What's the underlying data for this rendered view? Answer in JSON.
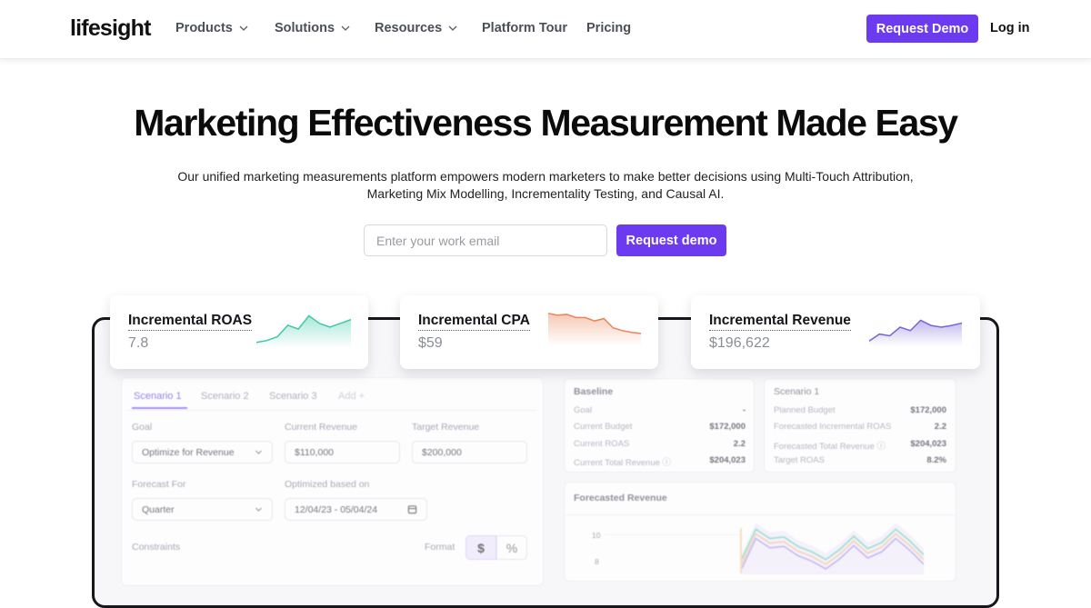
{
  "nav": {
    "logo": "lifesight",
    "items": [
      {
        "label": "Products",
        "has_dropdown": true
      },
      {
        "label": "Solutions",
        "has_dropdown": true
      },
      {
        "label": "Resources",
        "has_dropdown": true
      },
      {
        "label": "Platform Tour",
        "has_dropdown": false
      },
      {
        "label": "Pricing",
        "has_dropdown": false
      }
    ],
    "cta": "Request Demo",
    "login": "Log in"
  },
  "hero": {
    "title": "Marketing Effectiveness Measurement Made Easy",
    "subtitle_line1": "Our unified marketing measurements platform empowers modern marketers to make better decisions using Multi-Touch Attribution,",
    "subtitle_line2": "Marketing Mix Modelling, Incrementality Testing, and Causal AI.",
    "email_placeholder": "Enter your work email",
    "cta": "Request demo"
  },
  "colors": {
    "accent": "#6c3bf0",
    "roas_line": "#3ec9a7",
    "cpa_line": "#e8865a",
    "revenue_line": "#7a63d8"
  },
  "metric_cards": [
    {
      "title": "Incremental ROAS",
      "value": "7.8",
      "trend": "up",
      "sparkline": [
        1,
        1.5,
        2.5,
        5.5,
        4.5,
        8,
        6,
        5,
        6,
        7
      ]
    },
    {
      "title": "Incremental CPA",
      "value": "$59",
      "trend": "down",
      "sparkline": [
        9,
        8.5,
        8.7,
        7.8,
        7.8,
        6.8,
        7.5,
        4.8,
        4,
        3.5,
        3.2
      ]
    },
    {
      "title": "Incremental Revenue",
      "value": "$196,622",
      "trend": "up",
      "sparkline": [
        1,
        3,
        2.5,
        5,
        4,
        7,
        5.5,
        5,
        5.5,
        6.2
      ]
    }
  ],
  "dashboard": {
    "tabs": [
      {
        "label": "Scenario 1",
        "active": true
      },
      {
        "label": "Scenario 2",
        "active": false
      },
      {
        "label": "Scenario 3",
        "active": false
      },
      {
        "label": "Add +",
        "active": false
      }
    ],
    "fields": {
      "goal_label": "Goal",
      "goal_value": "Optimize for Revenue",
      "current_revenue_label": "Current Revenue",
      "current_revenue_value": "$110,000",
      "target_revenue_label": "Target Revenue",
      "target_revenue_value": "$200,000",
      "forecast_for_label": "Forecast For",
      "forecast_for_value": "Quarter",
      "optimized_based_on_label": "Optimized based on",
      "optimized_based_on_value": "12/04/23 - 05/04/24",
      "constraints_label": "Constraints",
      "format_label": "Format",
      "format_options": [
        "$",
        "%"
      ],
      "format_selected": "$"
    },
    "baseline": {
      "title": "Baseline",
      "rows": [
        {
          "label": "Goal",
          "value": "-"
        },
        {
          "label": "Current Budget",
          "value": "$172,000"
        },
        {
          "label": "Current ROAS",
          "value": "2.2"
        },
        {
          "label": "Current Total Revenue ⓘ",
          "value": "$204,023"
        }
      ]
    },
    "scenario": {
      "title": "Scenario 1",
      "rows": [
        {
          "label": "Planned Budget",
          "value": "$172,000"
        },
        {
          "label": "Forecasted Incremental ROAS",
          "value": "2.2"
        },
        {
          "label": "Forecasted Total Revenue ⓘ",
          "value": "$204,023"
        },
        {
          "label": "Target ROAS",
          "value": "8.2%"
        }
      ]
    },
    "forecast": {
      "title": "Forecasted Revenue",
      "y_ticks": [
        "10",
        "8"
      ],
      "series": [
        {
          "name": "upper",
          "color": "#7fd8c0",
          "values": [
            6,
            9.8,
            8.6,
            8.8,
            7.6,
            6.9,
            5.9,
            7.2,
            8.9,
            7.3,
            8.1,
            9.8,
            8.3,
            6.5
          ]
        },
        {
          "name": "mid",
          "color": "#f3c8a2",
          "values": [
            5.4,
            9.2,
            8,
            8.2,
            7,
            6.3,
            5.3,
            6.6,
            8.3,
            6.7,
            7.5,
            9.2,
            7.7,
            5.9
          ]
        },
        {
          "name": "lower",
          "color": "#b9a4ee",
          "values": [
            4.8,
            8.6,
            7.4,
            7.6,
            6.4,
            5.7,
            4.7,
            6,
            7.7,
            6.1,
            6.9,
            8.6,
            7.1,
            5.3
          ]
        }
      ]
    }
  }
}
